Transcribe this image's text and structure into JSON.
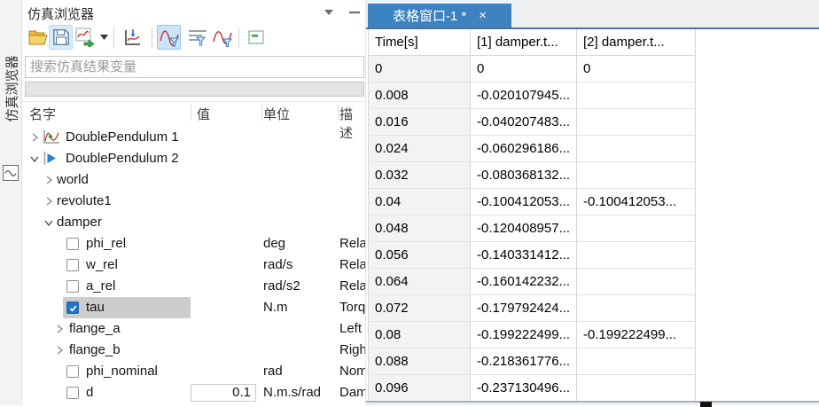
{
  "strip": {
    "label": "仿真浏览器",
    "icon": "sine-wave-icon"
  },
  "panel": {
    "title": "仿真浏览器",
    "title_buttons": [
      "dropdown-arrow-icon",
      "minimize-icon"
    ],
    "toolbar": {
      "icons": [
        "open-folder-icon",
        "save-icon",
        "export-plot-icon",
        "dropdown-arrow-icon",
        "plot-probe-icon",
        "filter-curve-icon",
        "filter-lines-icon",
        "filter-curve-alt-icon",
        "collapse-box-icon"
      ]
    },
    "search": {
      "placeholder": "搜索仿真结果变量",
      "value": ""
    },
    "columns": [
      "名字",
      "值",
      "单位",
      "描述"
    ],
    "tree": [
      {
        "label": "DoublePendulum 1",
        "level": 0,
        "expander": "collapsed",
        "icon": "chart"
      },
      {
        "label": "DoublePendulum 2",
        "level": 0,
        "expander": "expanded",
        "icon": "play"
      },
      {
        "label": "world",
        "level": 1,
        "expander": "collapsed"
      },
      {
        "label": "revolute1",
        "level": 1,
        "expander": "collapsed"
      },
      {
        "label": "damper",
        "level": 1,
        "expander": "expanded"
      },
      {
        "label": "phi_rel",
        "level": 2,
        "checkbox": true,
        "checked": false,
        "unit": "deg",
        "desc": "Rela"
      },
      {
        "label": "w_rel",
        "level": 2,
        "checkbox": true,
        "checked": false,
        "unit": "rad/s",
        "desc": "Rela"
      },
      {
        "label": "a_rel",
        "level": 2,
        "checkbox": true,
        "checked": false,
        "unit": "rad/s2",
        "desc": "Rela"
      },
      {
        "label": "tau",
        "level": 2,
        "checkbox": true,
        "checked": true,
        "selected": true,
        "unit": "N.m",
        "desc": "Torq"
      },
      {
        "label": "flange_a",
        "level": 2,
        "expander": "collapsed",
        "desc": "Left"
      },
      {
        "label": "flange_b",
        "level": 2,
        "expander": "collapsed",
        "desc": "Righ"
      },
      {
        "label": "phi_nominal",
        "level": 2,
        "checkbox": true,
        "checked": false,
        "unit": "rad",
        "desc": "Nom"
      },
      {
        "label": "d",
        "level": 2,
        "checkbox": true,
        "checked": false,
        "value": "0.1",
        "unit": "N.m.s/rad",
        "desc": "Dam"
      }
    ]
  },
  "table_window": {
    "tab": {
      "title": "表格窗口-1 *",
      "close": "×"
    },
    "columns": [
      "Time[s]",
      "[1] damper.t...",
      "[2] damper.t..."
    ],
    "rows": [
      [
        "0",
        "0",
        "0"
      ],
      [
        "0.008",
        "-0.020107945...",
        ""
      ],
      [
        "0.016",
        "-0.040207483...",
        ""
      ],
      [
        "0.024",
        "-0.060296186...",
        ""
      ],
      [
        "0.032",
        "-0.080368132...",
        ""
      ],
      [
        "0.04",
        "-0.100412053...",
        "-0.100412053..."
      ],
      [
        "0.048",
        "-0.120408957...",
        ""
      ],
      [
        "0.056",
        "-0.140331412...",
        ""
      ],
      [
        "0.064",
        "-0.160142232...",
        ""
      ],
      [
        "0.072",
        "-0.179792424...",
        ""
      ],
      [
        "0.08",
        "-0.199222499...",
        "-0.199222499..."
      ],
      [
        "0.088",
        "-0.218361776...",
        ""
      ],
      [
        "0.096",
        "-0.237130496...",
        ""
      ]
    ]
  },
  "colors": {
    "tab_blue": "#3e83c1",
    "tab_underline": "#51719b",
    "selection_gray": "#cdcdcd",
    "checkbox_blue": "#2471c8",
    "time_column_bg": "#f3f3f3",
    "toolbar_highlight": "#d9ecfb"
  }
}
